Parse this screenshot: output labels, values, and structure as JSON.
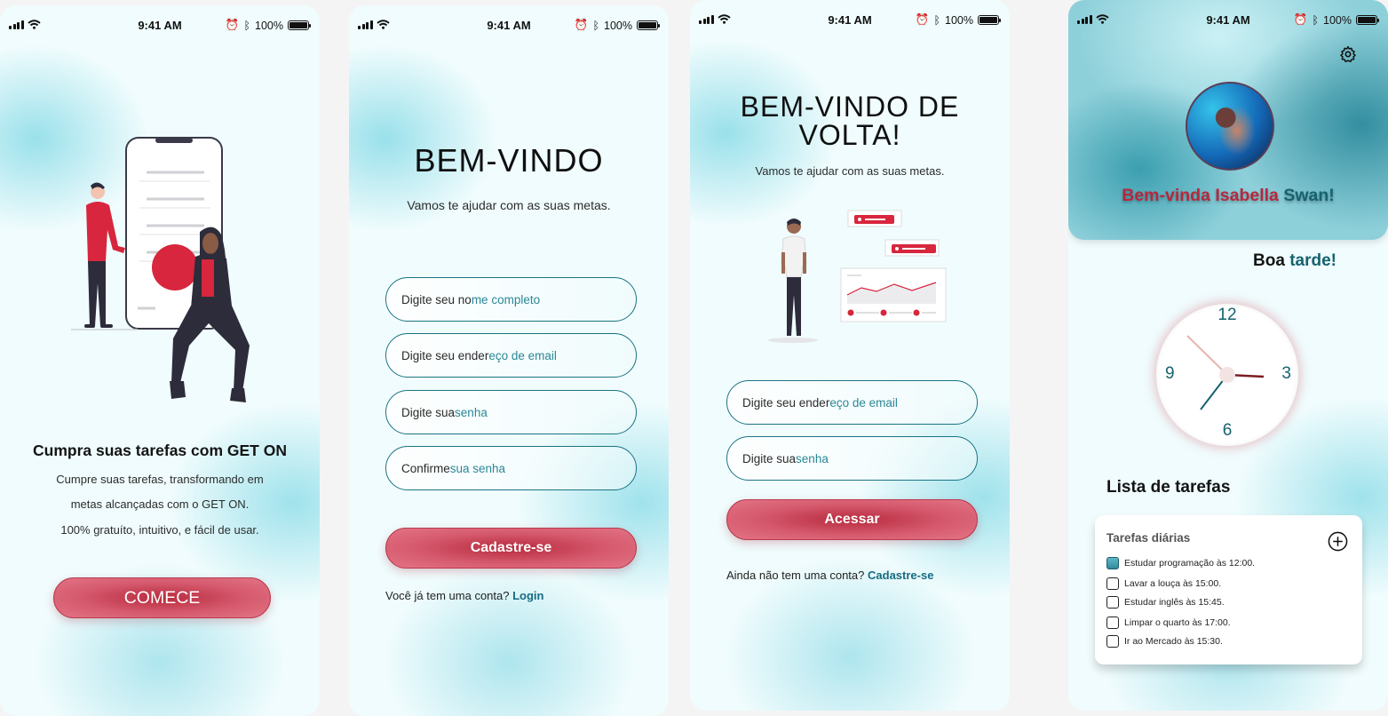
{
  "status_bar": {
    "time": "9:41 AM",
    "battery": "100%"
  },
  "screen1": {
    "headline": "Cumpra suas tarefas com GET ON",
    "lines": [
      "Cumpre suas tarefas, transformando em",
      "metas alcançadas com o GET ON.",
      "100% gratuíto, intuitivo, e fácil de usar."
    ],
    "cta": "COMECE"
  },
  "screen2": {
    "title": "BEM-VINDO",
    "subtitle": "Vamos te ajudar com as suas metas.",
    "fields": [
      {
        "a": "Digite seu no",
        "b": "me completo"
      },
      {
        "a": "Digite seu ender",
        "b": "eço de email"
      },
      {
        "a": "Digite sua ",
        "b": "senha"
      },
      {
        "a": "Confirme ",
        "b": "sua senha"
      }
    ],
    "button": "Cadastre-se",
    "footer_text": "Você já tem uma conta?",
    "footer_link": "Login"
  },
  "screen3": {
    "title_line1": "BEM-VINDO DE",
    "title_line2": "VOLTA!",
    "subtitle": "Vamos te ajudar com as suas metas.",
    "fields": [
      {
        "a": "Digite seu ender",
        "b": "eço de email"
      },
      {
        "a": "Digite sua ",
        "b": "senha"
      }
    ],
    "button": "Acessar",
    "footer_text": "Ainda não tem uma conta?",
    "footer_link": "Cadastre-se"
  },
  "screen4": {
    "welcome_a": "Bem-vinda Isabella",
    "welcome_b": " Swan!",
    "greeting_a": "Boa ",
    "greeting_b": "tarde!",
    "clock_numbers": [
      "12",
      "3",
      "6",
      "9"
    ],
    "list_title": "Lista de tarefas",
    "card_title": "Tarefas diárias",
    "tasks": [
      {
        "label": "Estudar programação às 12:00.",
        "done": true
      },
      {
        "label": "Lavar a louça às 15:00.",
        "done": false
      },
      {
        "label": "Estudar inglês às 15:45.",
        "done": false
      },
      {
        "label": "Limpar o quarto às 17:00.",
        "done": false
      },
      {
        "label": "Ir ao Mercado às 15:30.",
        "done": false
      }
    ]
  },
  "colors": {
    "accent_red": "#c73a50",
    "accent_teal": "#166b80",
    "background": "#f0fcfd"
  },
  "icons": [
    "signal-icon",
    "wifi-icon",
    "alarm-icon",
    "bluetooth-icon",
    "battery-icon",
    "gear-icon",
    "plus-circle-icon",
    "checkbox-icon"
  ]
}
